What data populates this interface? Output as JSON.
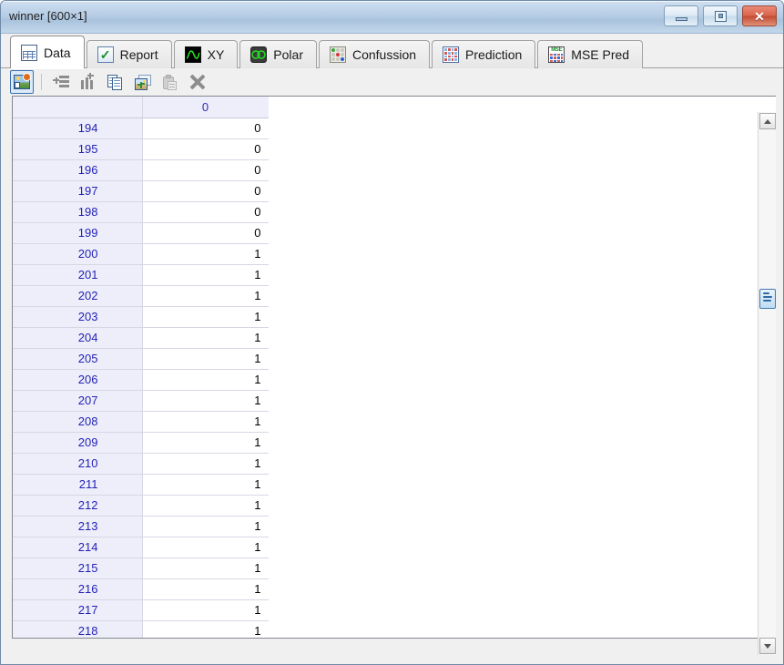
{
  "window": {
    "title": "winner [600×1]",
    "controls": {
      "minimize": "minimize-button",
      "maximize": "maximize-button",
      "close": "✕"
    }
  },
  "tabs": [
    {
      "label": "Data",
      "icon": "table-icon",
      "active": true
    },
    {
      "label": "Report",
      "icon": "checkmark-icon",
      "active": false
    },
    {
      "label": "XY",
      "icon": "waveform-icon",
      "active": false
    },
    {
      "label": "Polar",
      "icon": "polar-plot-icon",
      "active": false
    },
    {
      "label": "Confussion",
      "icon": "confusion-matrix-icon",
      "active": false
    },
    {
      "label": "Prediction",
      "icon": "prediction-grid-icon",
      "active": false
    },
    {
      "label": "MSE Pred",
      "icon": "mse-grid-icon",
      "active": false
    }
  ],
  "toolbar": [
    {
      "name": "save-image-button",
      "icon": "image-save-icon",
      "state": "selected"
    },
    {
      "name": "separator",
      "icon": "separator",
      "state": "static"
    },
    {
      "name": "insert-row-button",
      "icon": "insert-row-icon",
      "state": "enabled"
    },
    {
      "name": "insert-column-button",
      "icon": "insert-column-icon",
      "state": "enabled"
    },
    {
      "name": "copy-button",
      "icon": "copy-icon",
      "state": "enabled"
    },
    {
      "name": "paste-image-button",
      "icon": "paste-image-icon",
      "state": "enabled"
    },
    {
      "name": "clipboard-button",
      "icon": "clipboard-icon",
      "state": "disabled"
    },
    {
      "name": "delete-button",
      "icon": "close-x-icon",
      "state": "enabled"
    }
  ],
  "table": {
    "corner_label": "",
    "columns": [
      "0"
    ],
    "rows": [
      {
        "index": "194",
        "values": [
          "0"
        ]
      },
      {
        "index": "195",
        "values": [
          "0"
        ]
      },
      {
        "index": "196",
        "values": [
          "0"
        ]
      },
      {
        "index": "197",
        "values": [
          "0"
        ]
      },
      {
        "index": "198",
        "values": [
          "0"
        ]
      },
      {
        "index": "199",
        "values": [
          "0"
        ]
      },
      {
        "index": "200",
        "values": [
          "1"
        ]
      },
      {
        "index": "201",
        "values": [
          "1"
        ]
      },
      {
        "index": "202",
        "values": [
          "1"
        ]
      },
      {
        "index": "203",
        "values": [
          "1"
        ]
      },
      {
        "index": "204",
        "values": [
          "1"
        ]
      },
      {
        "index": "205",
        "values": [
          "1"
        ]
      },
      {
        "index": "206",
        "values": [
          "1"
        ]
      },
      {
        "index": "207",
        "values": [
          "1"
        ]
      },
      {
        "index": "208",
        "values": [
          "1"
        ]
      },
      {
        "index": "209",
        "values": [
          "1"
        ]
      },
      {
        "index": "210",
        "values": [
          "1"
        ]
      },
      {
        "index": "211",
        "values": [
          "1"
        ]
      },
      {
        "index": "212",
        "values": [
          "1"
        ]
      },
      {
        "index": "213",
        "values": [
          "1"
        ]
      },
      {
        "index": "214",
        "values": [
          "1"
        ]
      },
      {
        "index": "215",
        "values": [
          "1"
        ]
      },
      {
        "index": "216",
        "values": [
          "1"
        ]
      },
      {
        "index": "217",
        "values": [
          "1"
        ]
      },
      {
        "index": "218",
        "values": [
          "1"
        ]
      }
    ]
  },
  "scrollbar": {
    "up_arrow": "scroll-up-icon",
    "down_arrow": "scroll-down-icon",
    "thumb": "scroll-thumb"
  },
  "colors": {
    "titlebar": "#b7cde5",
    "row_header_bg": "#eeeefb",
    "row_header_text": "#2222b5",
    "column_header_text": "#2b2bbd",
    "accent": "#3f77b5",
    "close_button": "#c24b33"
  }
}
